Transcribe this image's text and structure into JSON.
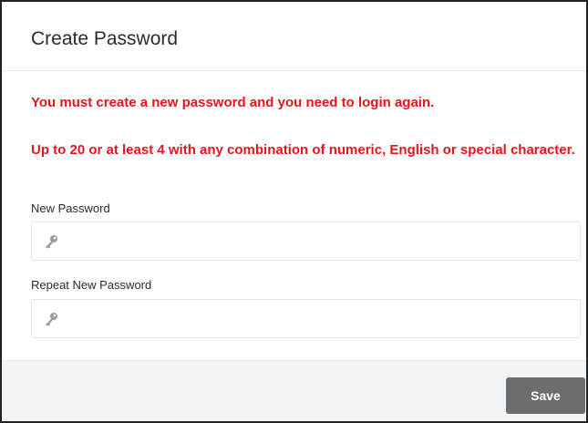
{
  "dialog": {
    "title": "Create Password",
    "messages": [
      "You must create a new password and you need to login again.",
      "Up to 20 or at least 4 with any combination of numeric, English or special character."
    ],
    "message_color": "#e8141c",
    "fields": [
      {
        "label": "New Password",
        "value": "",
        "icon": "key-icon"
      },
      {
        "label": "Repeat New Password",
        "value": "",
        "icon": "key-icon"
      }
    ],
    "save_label": "Save",
    "save_color": "#6d6d6d",
    "footer_color": "#f2f5f8"
  }
}
